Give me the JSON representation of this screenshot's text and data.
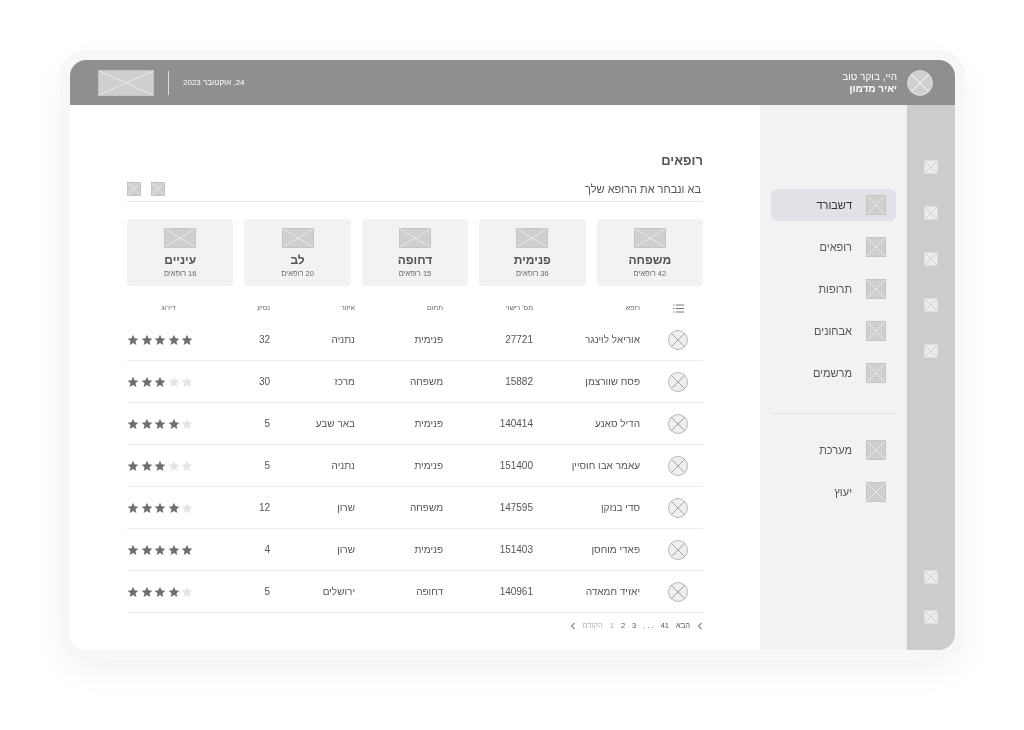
{
  "header": {
    "greeting": "היי, בוקר טוב",
    "user_name": "יאיר מדמון",
    "date": "24, אוקטובר 2023"
  },
  "page": {
    "title": "רופאים",
    "search": {
      "placeholder": "בא ונבחר את הרופא שלך"
    }
  },
  "categories": [
    {
      "name": "משפחה",
      "count": "42 רופאים"
    },
    {
      "name": "פנימית",
      "count": "36 רופאים"
    },
    {
      "name": "דחופה",
      "count": "15 רופאים"
    },
    {
      "name": "לב",
      "count": "20 רופאים"
    },
    {
      "name": "עיניים",
      "count": "16 רופאים"
    }
  ],
  "table": {
    "columns": [
      "רופא",
      "מס' רישוי",
      "תחום",
      "איזור",
      "נסיון",
      "דירוג"
    ],
    "rows": [
      {
        "name": "אוריאל לוינגר",
        "license": "27721",
        "field": "פנימית",
        "area": "נתניה",
        "experience": "32",
        "stars": 5
      },
      {
        "name": "פסח שוורצמן",
        "license": "15882",
        "field": "משפחה",
        "area": "מרכז",
        "experience": "30",
        "stars": 3
      },
      {
        "name": "הדיל סאנע",
        "license": "140414",
        "field": "פנימית",
        "area": "באר שבע",
        "experience": "5",
        "stars": 4
      },
      {
        "name": "עאמר אבו חוסיין",
        "license": "151400",
        "field": "פנימית",
        "area": "נתניה",
        "experience": "5",
        "stars": 3
      },
      {
        "name": "סדי בנזקן",
        "license": "147595",
        "field": "משפחה",
        "area": "שרון",
        "experience": "12",
        "stars": 4
      },
      {
        "name": "פאדי מוחסן",
        "license": "151403",
        "field": "פנימית",
        "area": "שרון",
        "experience": "4",
        "stars": 5
      },
      {
        "name": "יאזיד חמאדה",
        "license": "140961",
        "field": "דחופה",
        "area": "ירושלים",
        "experience": "5",
        "stars": 4
      }
    ]
  },
  "pagination": {
    "next": {
      "label": "הבא",
      "disabled": false
    },
    "pages": [
      {
        "label": "41",
        "selected": false
      },
      {
        "label": ". . .",
        "selected": false
      },
      {
        "label": "3",
        "selected": false
      },
      {
        "label": "2",
        "selected": false
      },
      {
        "label": "1",
        "selected": true
      }
    ],
    "previous": {
      "label": "הקודם",
      "disabled": true
    }
  },
  "sidebar": {
    "items": [
      {
        "label": "דשבורד",
        "selected": true
      },
      {
        "label": "רופאים",
        "selected": false
      },
      {
        "label": "תרופות",
        "selected": false
      },
      {
        "label": "אבחונים",
        "selected": false
      },
      {
        "label": "מרשמים",
        "selected": false
      }
    ],
    "bottom_items": [
      {
        "label": "מערכת",
        "selected": false
      },
      {
        "label": "יעוץ",
        "selected": false
      }
    ]
  }
}
